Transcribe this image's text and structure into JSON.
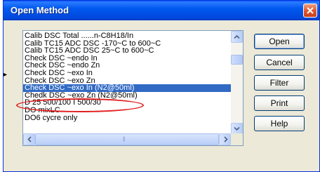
{
  "window": {
    "title": "Open Method"
  },
  "list": {
    "items": [
      "Calib DSC Total ......n-C8H18/In",
      "Calib TC15 ADC DSC -170~C to 600~C",
      "Calib TC15 ADC DSC 25~C to 600~C",
      "Check DSC ~endo In",
      "Check DSC ~endo Zn",
      "Check DSC ~exo In",
      "Check DSC ~exo Zn",
      "Check DSC ~exo In (N2@50ml)",
      "Chedk DSC ~exo Zn (N2@50ml)",
      "D 25 500/100 I 500/30",
      "DO mixLC",
      "DO6 cycre only"
    ],
    "selected_index": 7
  },
  "buttons": {
    "open": "Open",
    "cancel": "Cancel",
    "filter": "Filter",
    "print": "Print",
    "help": "Help"
  },
  "colors": {
    "titlebar": "#0054e3",
    "selection": "#316ac5",
    "annotation": "#e02020"
  }
}
